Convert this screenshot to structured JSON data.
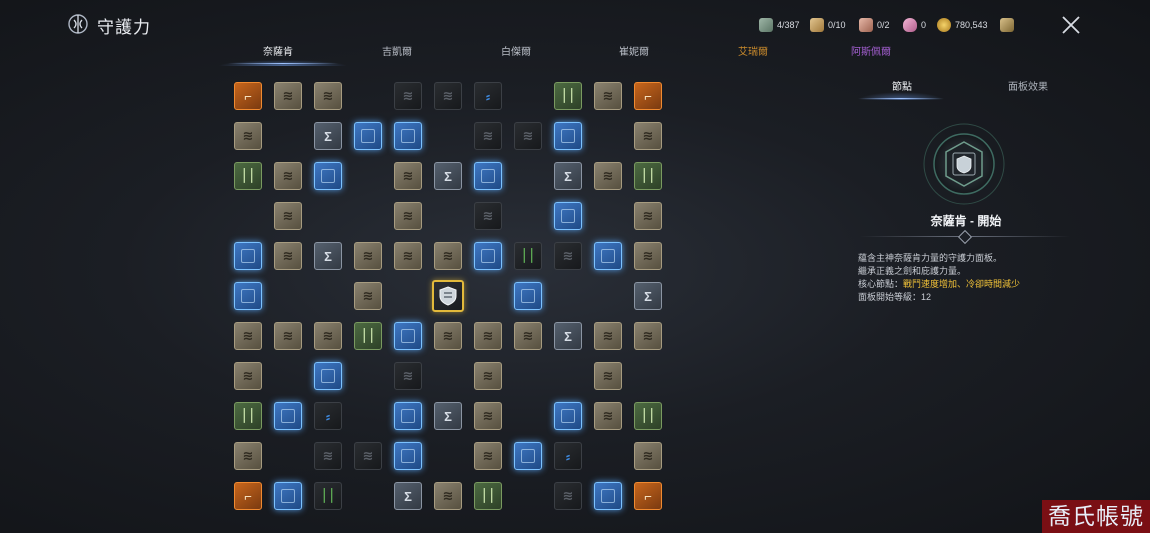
{
  "header": {
    "title": "守護力",
    "resources": [
      {
        "icon": "gem-icon",
        "value": "4/387"
      },
      {
        "icon": "scroll-icon",
        "value": "0/10"
      },
      {
        "icon": "bag-icon",
        "value": "0/2"
      },
      {
        "icon": "crystal-icon",
        "value": "0"
      },
      {
        "icon": "coin-icon",
        "value": "780,543"
      },
      {
        "icon": "chest-icon",
        "value": ""
      }
    ]
  },
  "tabs": [
    {
      "label": "奈薩肯",
      "color": "#f0f2f5",
      "active": true
    },
    {
      "label": "吉凱爾",
      "color": "#b9bec7",
      "active": false
    },
    {
      "label": "白傑爾",
      "color": "#b9bec7",
      "active": false
    },
    {
      "label": "崔妮爾",
      "color": "#b9bec7",
      "active": false
    },
    {
      "label": "艾瑞爾",
      "color": "#c98a2c",
      "active": false
    },
    {
      "label": "阿斯佩爾",
      "color": "#a35fd0",
      "active": false
    }
  ],
  "board": {
    "grid": [
      [
        "orange",
        "gold",
        "gold",
        "",
        "dark",
        "dark",
        "darkblue",
        "",
        "green",
        "gold",
        "orange"
      ],
      [
        "gold",
        "",
        "slate",
        "blue",
        "blue",
        "",
        "dark",
        "dark",
        "blue",
        "",
        "gold"
      ],
      [
        "green",
        "gold",
        "blue",
        "",
        "gold",
        "slate",
        "blue",
        "",
        "slate",
        "gold",
        "green"
      ],
      [
        "",
        "gold",
        "",
        "",
        "gold",
        "",
        "dark",
        "",
        "blue",
        "",
        "gold"
      ],
      [
        "blue",
        "gold",
        "slate",
        "gold",
        "gold",
        "gold",
        "blue",
        "darkgreen",
        "dark",
        "blue",
        "gold"
      ],
      [
        "blue",
        "",
        "",
        "gold",
        "",
        "center",
        "",
        "blue",
        "",
        "",
        "slate"
      ],
      [
        "gold",
        "gold",
        "gold",
        "green",
        "blue",
        "gold",
        "gold",
        "gold",
        "slate",
        "gold",
        "gold"
      ],
      [
        "gold",
        "",
        "blue",
        "",
        "dark",
        "",
        "gold",
        "",
        "",
        "gold",
        ""
      ],
      [
        "green",
        "blue",
        "darkblue",
        "",
        "blue",
        "slate",
        "gold",
        "",
        "blue",
        "gold",
        "green"
      ],
      [
        "gold",
        "",
        "dark",
        "dark",
        "blue",
        "",
        "gold",
        "blue",
        "darkblue",
        "",
        "gold"
      ],
      [
        "orange",
        "blue",
        "darkgreen",
        "",
        "slate",
        "gold",
        "green",
        "",
        "dark",
        "blue",
        "orange"
      ]
    ]
  },
  "detail": {
    "tabs": [
      "節點",
      "面板效果"
    ],
    "node_name": "奈薩肯 - 開始",
    "desc_line1": "蘊含主神奈薩肯力量的守護力面板。",
    "desc_line2": "繼承正義之劍和庇護力量。",
    "core_label": "核心節點：",
    "core_value": "戰鬥速度增加、冷卻時間減少",
    "level_line": "面板開始等級：12"
  },
  "watermark": "喬氏帳號"
}
